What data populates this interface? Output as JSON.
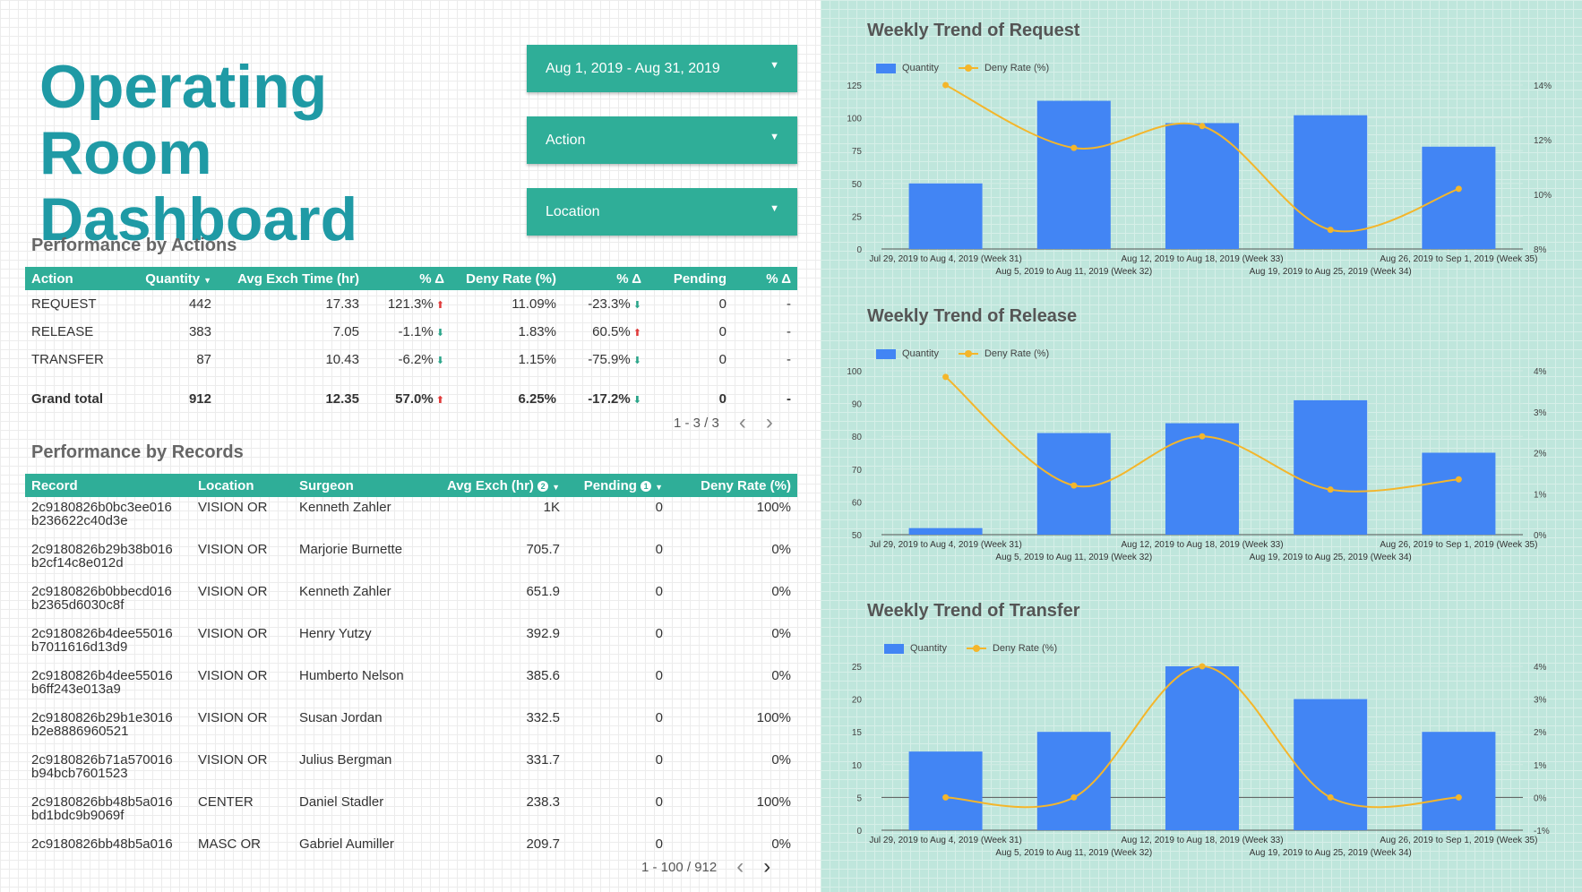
{
  "title": "Operating Room Dashboard",
  "filters": {
    "date_range": "Aug 1, 2019 - Aug 31, 2019",
    "action": "Action",
    "location": "Location"
  },
  "actions": {
    "title": "Performance by Actions",
    "headers": [
      "Action",
      "Quantity",
      "Avg Exch Time (hr)",
      "% Δ",
      "Deny Rate (%)",
      "% Δ",
      "Pending",
      "% Δ"
    ],
    "rows": [
      {
        "action": "REQUEST",
        "quantity": "442",
        "avg": "17.33",
        "avg_delta": "121.3%",
        "avg_dir": "up",
        "deny": "11.09%",
        "deny_delta": "-23.3%",
        "deny_dir": "down",
        "pending": "0",
        "pending_delta": "-"
      },
      {
        "action": "RELEASE",
        "quantity": "383",
        "avg": "7.05",
        "avg_delta": "-1.1%",
        "avg_dir": "down",
        "deny": "1.83%",
        "deny_delta": "60.5%",
        "deny_dir": "up",
        "pending": "0",
        "pending_delta": "-"
      },
      {
        "action": "TRANSFER",
        "quantity": "87",
        "avg": "10.43",
        "avg_delta": "-6.2%",
        "avg_dir": "down",
        "deny": "1.15%",
        "deny_delta": "-75.9%",
        "deny_dir": "down",
        "pending": "0",
        "pending_delta": "-"
      }
    ],
    "total": {
      "action": "Grand total",
      "quantity": "912",
      "avg": "12.35",
      "avg_delta": "57.0%",
      "avg_dir": "up",
      "deny": "6.25%",
      "deny_delta": "-17.2%",
      "deny_dir": "down",
      "pending": "0",
      "pending_delta": "-"
    },
    "pager": "1 - 3 / 3"
  },
  "records": {
    "title": "Performance by Records",
    "headers": [
      "Record",
      "Location",
      "Surgeon",
      "Avg Exch (hr)",
      "Pending",
      "Deny Rate (%)"
    ],
    "header_badges": {
      "avg": "2",
      "pending": "1"
    },
    "rows": [
      {
        "record1": "2c9180826b0bc3ee016",
        "record2": "b236622c40d3e",
        "location": "VISION OR",
        "surgeon": "Kenneth Zahler",
        "avg": "1K",
        "pending": "0",
        "deny": "100%"
      },
      {
        "record1": "2c9180826b29b38b016",
        "record2": "b2cf14c8e012d",
        "location": "VISION OR",
        "surgeon": "Marjorie Burnette",
        "avg": "705.7",
        "pending": "0",
        "deny": "0%"
      },
      {
        "record1": "2c9180826b0bbecd016",
        "record2": "b2365d6030c8f",
        "location": "VISION OR",
        "surgeon": "Kenneth Zahler",
        "avg": "651.9",
        "pending": "0",
        "deny": "0%"
      },
      {
        "record1": "2c9180826b4dee55016",
        "record2": "b7011616d13d9",
        "location": "VISION OR",
        "surgeon": "Henry Yutzy",
        "avg": "392.9",
        "pending": "0",
        "deny": "0%"
      },
      {
        "record1": "2c9180826b4dee55016",
        "record2": "b6ff243e013a9",
        "location": "VISION OR",
        "surgeon": "Humberto Nelson",
        "avg": "385.6",
        "pending": "0",
        "deny": "0%"
      },
      {
        "record1": "2c9180826b29b1e3016",
        "record2": "b2e8886960521",
        "location": "VISION OR",
        "surgeon": "Susan Jordan",
        "avg": "332.5",
        "pending": "0",
        "deny": "100%"
      },
      {
        "record1": "2c9180826b71a570016",
        "record2": "b94bcb7601523",
        "location": "VISION OR",
        "surgeon": "Julius Bergman",
        "avg": "331.7",
        "pending": "0",
        "deny": "0%"
      },
      {
        "record1": "2c9180826bb48b5a016",
        "record2": "bd1bdc9b9069f",
        "location": "CENTER",
        "surgeon": "Daniel Stadler",
        "avg": "238.3",
        "pending": "0",
        "deny": "100%"
      },
      {
        "record1": "2c9180826bb48b5a016",
        "record2": "",
        "location": "MASC OR",
        "surgeon": "Gabriel Aumiller",
        "avg": "209.7",
        "pending": "0",
        "deny": "0%"
      }
    ],
    "pager": "1 - 100 / 912"
  },
  "icons": {
    "dropdown": "caret-down-icon",
    "sort": "sort-desc-icon",
    "up": "arrow-up-icon",
    "down": "arrow-down-icon",
    "prev": "chevron-left-icon",
    "next": "chevron-right-icon"
  },
  "colors": {
    "accent": "#2fae98",
    "title": "#1f9aa5",
    "bar": "#4285f4",
    "line": "#f4b62b",
    "up": "#e03a3a",
    "down": "#2aa58a"
  },
  "legend": {
    "bar": "Quantity",
    "line": "Deny Rate (%)"
  },
  "chart_data": [
    {
      "type": "bar",
      "title": "Weekly Trend of Request",
      "categories": [
        "Jul 29, 2019 to Aug 4, 2019 (Week 31)",
        "Aug 5, 2019 to Aug 11, 2019 (Week 32)",
        "Aug 12, 2019 to Aug 18, 2019 (Week 33)",
        "Aug 19, 2019 to Aug 25, 2019 (Week 34)",
        "Aug 26, 2019 to Sep 1, 2019 (Week 35)"
      ],
      "series": [
        {
          "name": "Quantity",
          "type": "bar",
          "axis": "left",
          "values": [
            50,
            113,
            96,
            102,
            78
          ]
        },
        {
          "name": "Deny Rate (%)",
          "type": "line",
          "axis": "right",
          "values": [
            14.0,
            11.7,
            12.5,
            8.7,
            10.2
          ]
        }
      ],
      "y_left": {
        "min": 0,
        "max": 125,
        "ticks": [
          0,
          25,
          50,
          75,
          100,
          125
        ]
      },
      "y_right": {
        "min": 8,
        "max": 14,
        "ticks": [
          8,
          10,
          12,
          14
        ],
        "suffix": "%"
      }
    },
    {
      "type": "bar",
      "title": "Weekly Trend of Release",
      "categories": [
        "Jul 29, 2019 to Aug 4, 2019 (Week 31)",
        "Aug 5, 2019 to Aug 11, 2019 (Week 32)",
        "Aug 12, 2019 to Aug 18, 2019 (Week 33)",
        "Aug 19, 2019 to Aug 25, 2019 (Week 34)",
        "Aug 26, 2019 to Sep 1, 2019 (Week 35)"
      ],
      "series": [
        {
          "name": "Quantity",
          "type": "bar",
          "axis": "left",
          "values": [
            52,
            81,
            84,
            91,
            75
          ]
        },
        {
          "name": "Deny Rate (%)",
          "type": "line",
          "axis": "right",
          "values": [
            3.85,
            1.2,
            2.4,
            1.1,
            1.35
          ]
        }
      ],
      "y_left": {
        "min": 50,
        "max": 100,
        "ticks": [
          50,
          60,
          70,
          80,
          90,
          100
        ]
      },
      "y_right": {
        "min": 0,
        "max": 4,
        "ticks": [
          0,
          1,
          2,
          3,
          4
        ],
        "suffix": "%"
      }
    },
    {
      "type": "bar",
      "title": "Weekly Trend of Transfer",
      "categories": [
        "Jul 29, 2019 to Aug 4, 2019 (Week 31)",
        "Aug 5, 2019 to Aug 11, 2019 (Week 32)",
        "Aug 12, 2019 to Aug 18, 2019 (Week 33)",
        "Aug 19, 2019 to Aug 25, 2019 (Week 34)",
        "Aug 26, 2019 to Sep 1, 2019 (Week 35)"
      ],
      "series": [
        {
          "name": "Quantity",
          "type": "bar",
          "axis": "left",
          "values": [
            12,
            15,
            25,
            20,
            15
          ]
        },
        {
          "name": "Deny Rate (%)",
          "type": "line",
          "axis": "right",
          "values": [
            0,
            0,
            4,
            0,
            0
          ]
        }
      ],
      "y_left": {
        "min": 0,
        "max": 25,
        "ticks": [
          0,
          5,
          10,
          15,
          20,
          25
        ]
      },
      "y_right": {
        "min": -1,
        "max": 4,
        "ticks": [
          -1,
          0,
          1,
          2,
          3,
          4
        ],
        "suffix": "%"
      }
    }
  ]
}
